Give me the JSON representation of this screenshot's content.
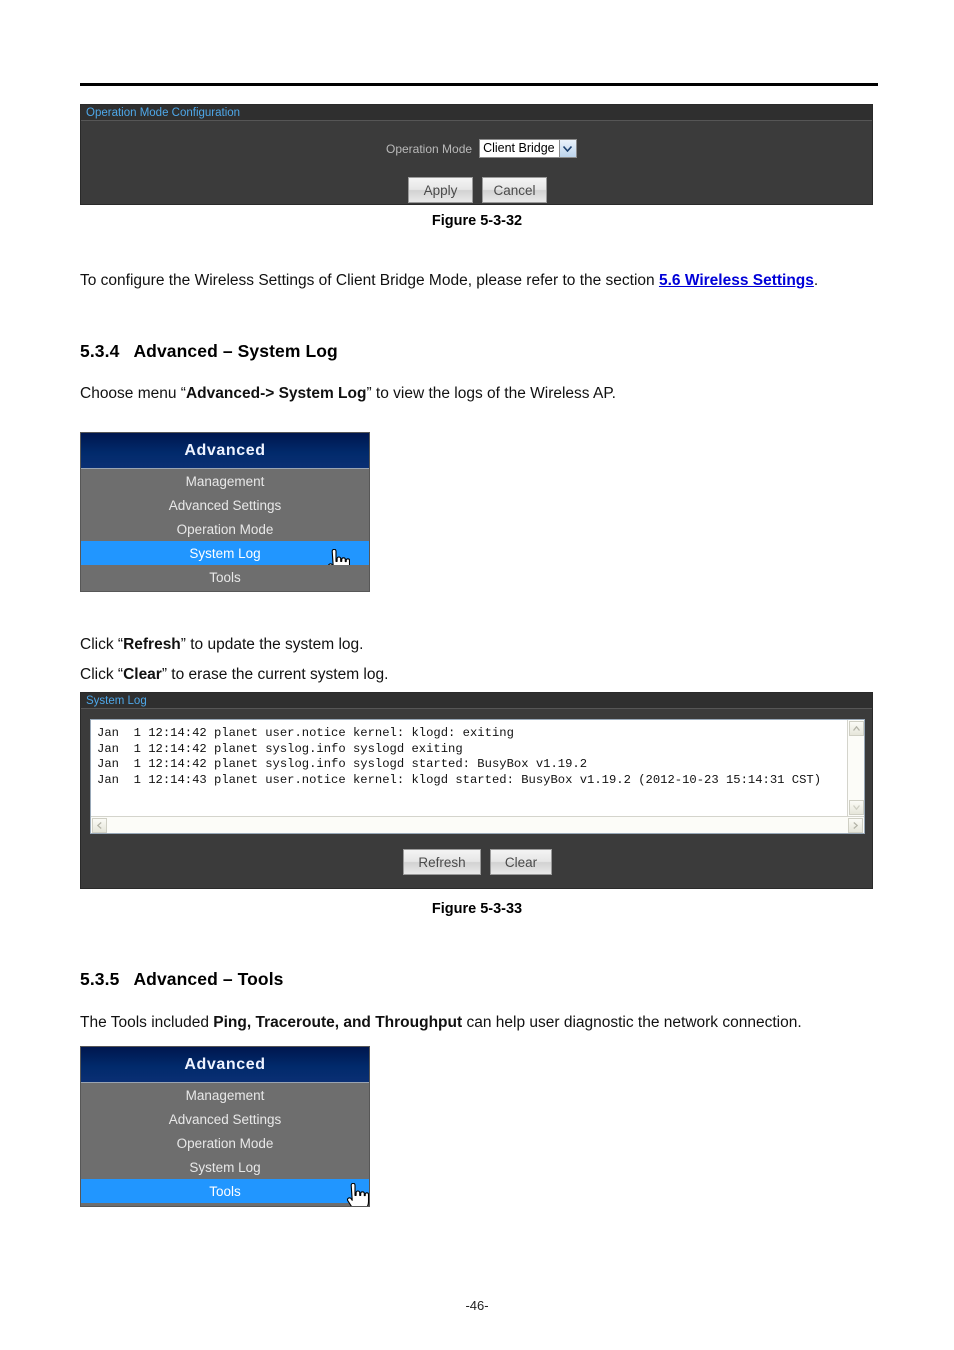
{
  "document": {
    "page_number": "-46-"
  },
  "operation_mode_panel": {
    "title": "Operation Mode Configuration",
    "field_label": "Operation Mode",
    "selected_value": "Client Bridge",
    "apply_label": "Apply",
    "cancel_label": "Cancel"
  },
  "figures": {
    "fig_32": "Figure 5-3-32",
    "fig_33": "Figure 5-3-33"
  },
  "paragraphs": {
    "client_bridge_ref_pre": "To configure the Wireless Settings of Client Bridge Mode, please refer to the section ",
    "client_bridge_ref_link": "5.6 Wireless Settings",
    "client_bridge_ref_post": ".",
    "choose_menu_pre": "Choose menu “",
    "choose_menu_bold": "Advanced-> System Log",
    "choose_menu_post": "” to view the logs of the Wireless AP.",
    "click_refresh_pre": "Click “",
    "click_refresh_bold": "Refresh",
    "click_refresh_post": "” to update the system log.",
    "click_clear_pre": "Click “",
    "click_clear_bold": "Clear",
    "click_clear_post": "” to erase the current system log.",
    "tools_intro_pre": "The Tools included ",
    "tools_intro_bold": "Ping, Traceroute, and Throughput",
    "tools_intro_post": " can help user diagnostic the network connection."
  },
  "sections": {
    "s534_num": "5.3.4",
    "s534_title": "Advanced – System Log",
    "s535_num": "5.3.5",
    "s535_title": "Advanced – Tools"
  },
  "advanced_menu_syslog": {
    "header": "Advanced",
    "items": [
      {
        "label": "Management",
        "selected": false
      },
      {
        "label": "Advanced Settings",
        "selected": false
      },
      {
        "label": "Operation Mode",
        "selected": false
      },
      {
        "label": "System Log",
        "selected": true
      },
      {
        "label": "Tools",
        "selected": false
      }
    ]
  },
  "advanced_menu_tools": {
    "header": "Advanced",
    "items": [
      {
        "label": "Management",
        "selected": false
      },
      {
        "label": "Advanced Settings",
        "selected": false
      },
      {
        "label": "Operation Mode",
        "selected": false
      },
      {
        "label": "System Log",
        "selected": false
      },
      {
        "label": "Tools",
        "selected": true
      }
    ]
  },
  "system_log_panel": {
    "title": "System Log",
    "log_text": "Jan  1 12:14:42 planet user.notice kernel: klogd: exiting\nJan  1 12:14:42 planet syslog.info syslogd exiting\nJan  1 12:14:42 planet syslog.info syslogd started: BusyBox v1.19.2\nJan  1 12:14:43 planet user.notice kernel: klogd started: BusyBox v1.19.2 (2012-10-23 15:14:31 CST)",
    "refresh_label": "Refresh",
    "clear_label": "Clear"
  },
  "colors": {
    "panel_bg": "#3b3b3b",
    "panel_title_text": "#4ea7e8",
    "menu_selected": "#2196ff",
    "menu_header_blue": "#012a6b",
    "link_blue": "#0000d8"
  }
}
